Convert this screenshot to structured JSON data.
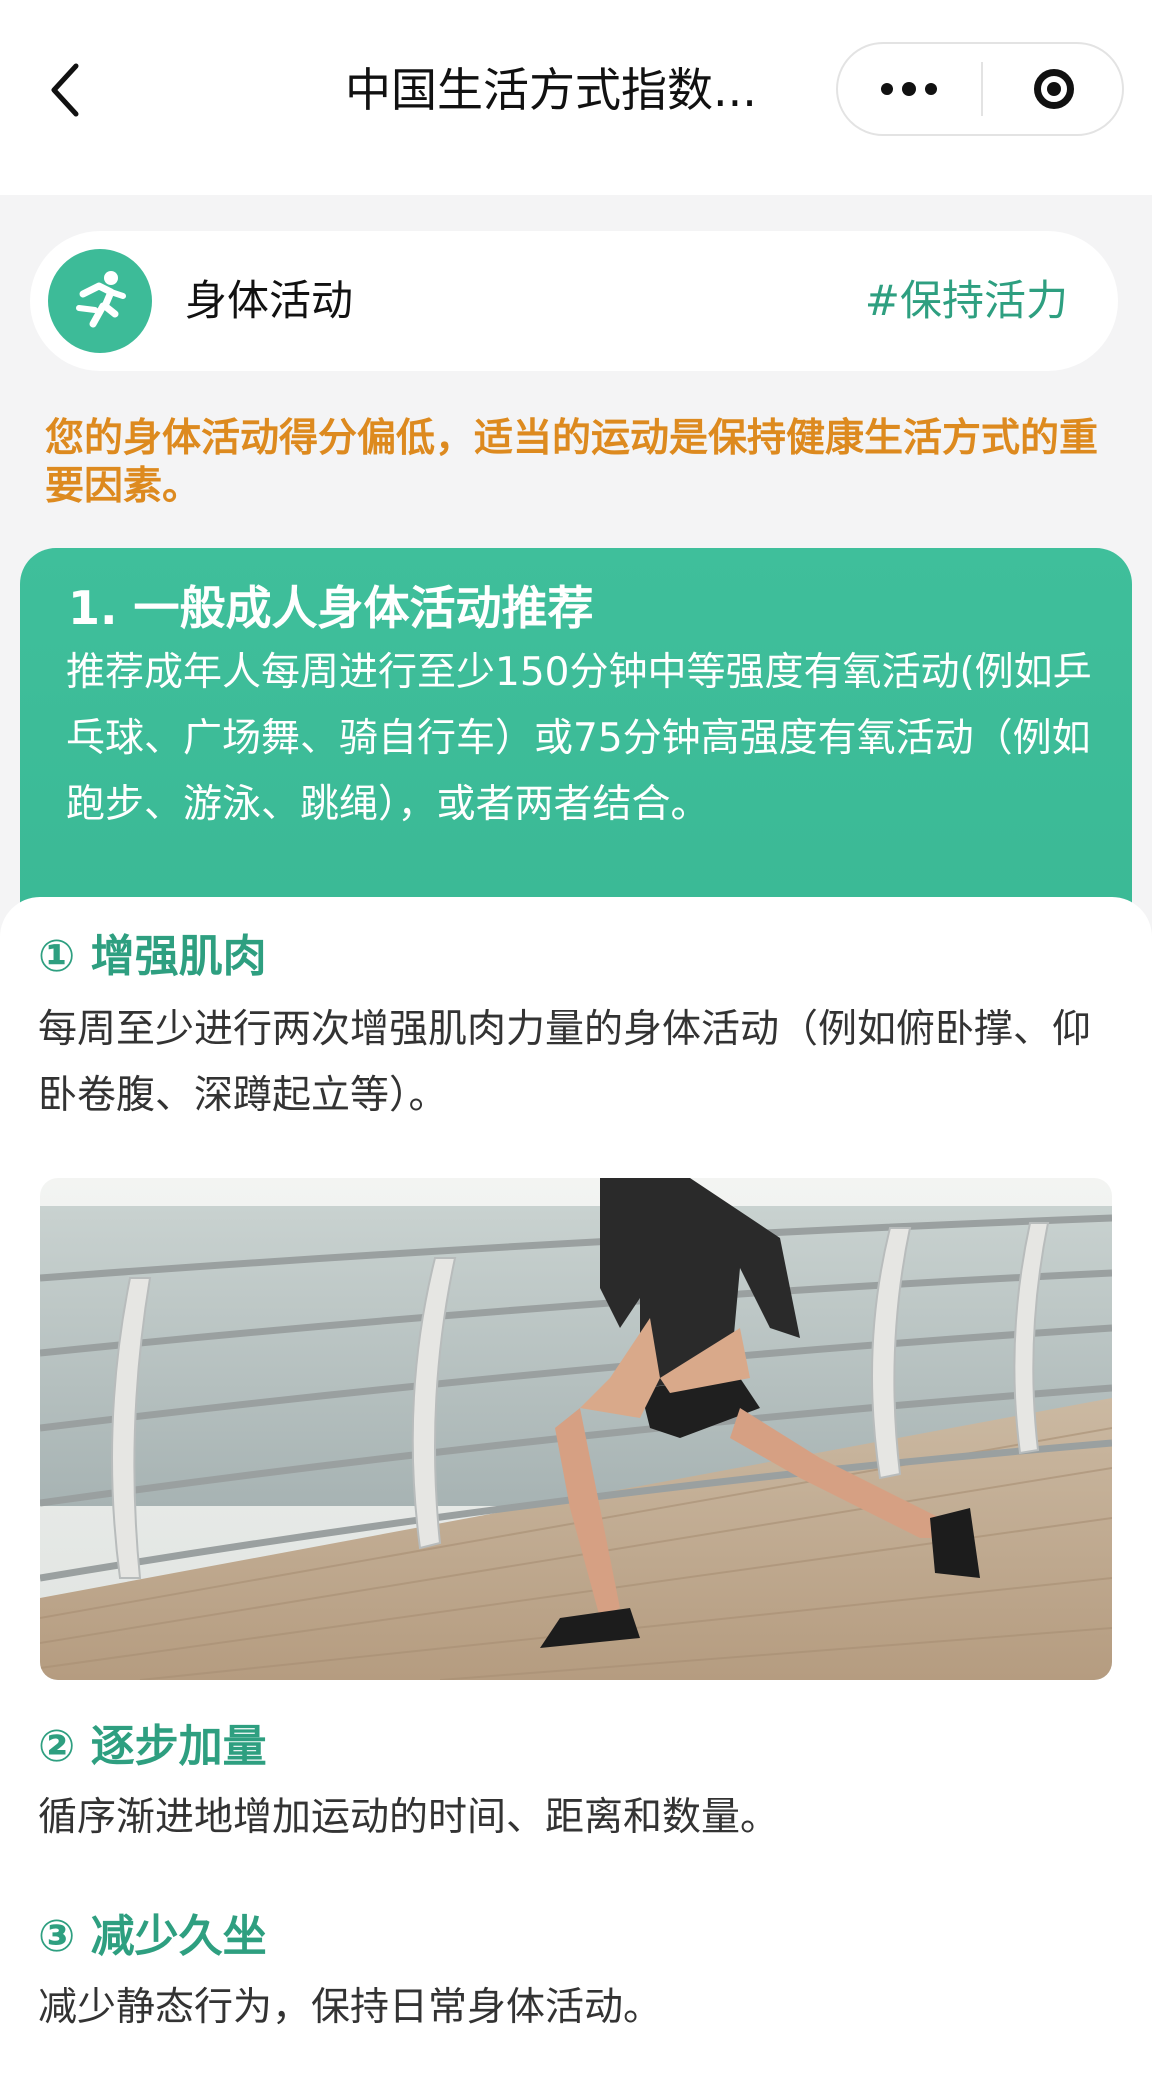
{
  "nav": {
    "title": "中国生活方式指数...",
    "back_icon": "chevron-left-icon",
    "more_icon": "more-dots-icon",
    "close_icon": "target-circle-icon"
  },
  "category": {
    "icon": "running-person-icon",
    "title": "身体活动",
    "tag": "#保持活力"
  },
  "warning": "您的身体活动得分偏低，适当的运动是保持健康生活方式的重要因素。",
  "recommendation": {
    "title": "1. 一般成人身体活动推荐",
    "body": "推荐成年人每周进行至少150分钟中等强度有氧活动(例如乒乓球、广场舞、骑自行车）或75分钟高强度有氧活动（例如跑步、游泳、跳绳），或者两者结合。"
  },
  "sections": [
    {
      "title": "① 增强肌肉",
      "text": "每周至少进行两次增强肌肉力量的身体活动（例如俯卧撑、仰卧卷腹、深蹲起立等）。"
    },
    {
      "title": "② 逐步加量",
      "text": "循序渐进地增加运动的时间、距离和数量。"
    },
    {
      "title": "③ 减少久坐",
      "text": "减少静态行为，保持日常身体活动。"
    }
  ],
  "colors": {
    "accent_green": "#3dbb98",
    "tag_green": "#2e9f80",
    "warning_orange": "#dd8a1f"
  }
}
